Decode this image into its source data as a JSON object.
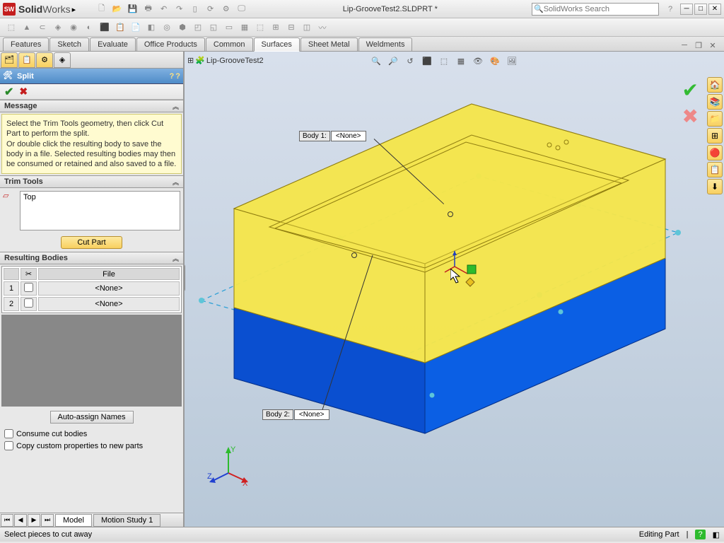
{
  "app": {
    "name1": "Solid",
    "name2": "Works",
    "filename": "Lip-GrooveTest2.SLDPRT *",
    "search_placeholder": "SolidWorks Search"
  },
  "tabs": [
    "Features",
    "Sketch",
    "Evaluate",
    "Office Products",
    "Common",
    "Surfaces",
    "Sheet Metal",
    "Weldments"
  ],
  "active_tab": "Surfaces",
  "tree_root": "Lip-GrooveTest2",
  "feature": {
    "title": "Split",
    "message_hdr": "Message",
    "message": "Select the Trim Tools geometry, then click Cut Part to perform the split.\nOr double click the resulting body to save the body in a file. Selected resulting bodies may then be consumed or retained and also saved to a file.",
    "trim_hdr": "Trim Tools",
    "trim_items": [
      "Top"
    ],
    "cutpart": "Cut Part",
    "result_hdr": "Resulting Bodies",
    "file_col": "File",
    "rows": [
      {
        "n": "1",
        "file": "<None>"
      },
      {
        "n": "2",
        "file": "<None>"
      }
    ],
    "auto": "Auto-assign Names",
    "consume": "Consume cut bodies",
    "copyprops": "Copy custom properties to new parts"
  },
  "bottom_tabs": [
    "Model",
    "Motion Study 1"
  ],
  "callouts": {
    "body1_label": "Body  1:",
    "body1_val": "<None>",
    "body2_label": "Body  2:",
    "body2_val": "<None>"
  },
  "triad": {
    "x": "X",
    "y": "Y",
    "z": "Z"
  },
  "status": {
    "left": "Select pieces to cut away",
    "mode": "Editing Part"
  }
}
